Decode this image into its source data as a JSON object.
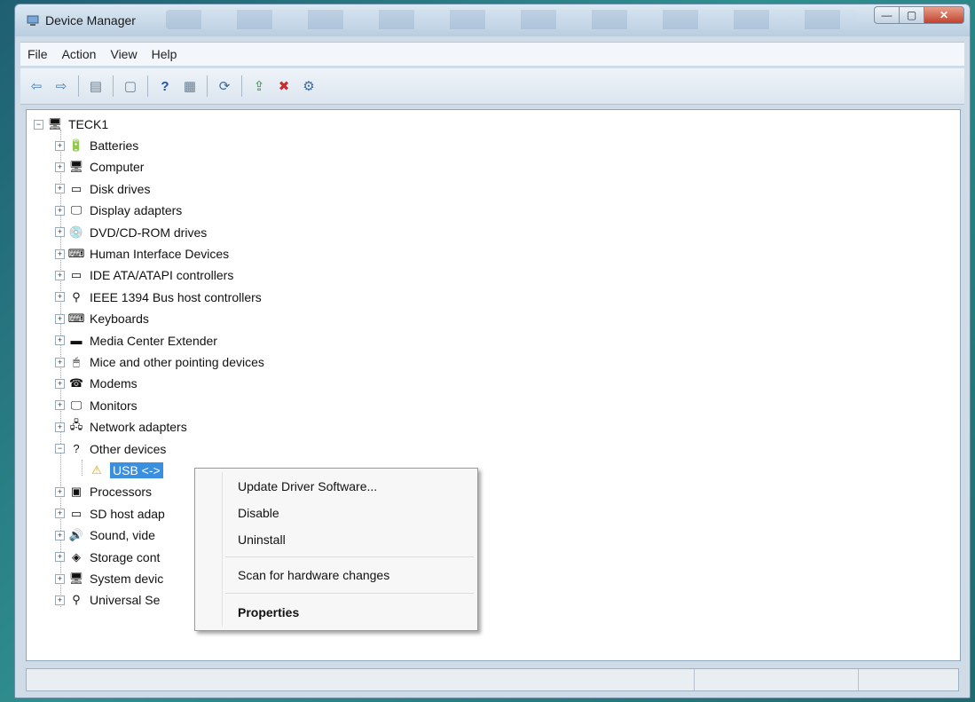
{
  "window": {
    "title": "Device Manager"
  },
  "menubar": [
    "File",
    "Action",
    "View",
    "Help"
  ],
  "toolbar": {
    "icons": [
      "back-arrow-icon",
      "forward-arrow-icon",
      "console-tree-icon",
      "properties-icon",
      "help-icon",
      "view-icon",
      "scan-hardware-icon",
      "update-driver-icon",
      "uninstall-icon",
      "disable-icon"
    ]
  },
  "tree": {
    "root": "TECK1",
    "items": [
      {
        "label": "Batteries",
        "icon": "battery-icon",
        "glyph": "🔋"
      },
      {
        "label": "Computer",
        "icon": "computer-icon",
        "glyph": "🖥"
      },
      {
        "label": "Disk drives",
        "icon": "disk-drive-icon",
        "glyph": "▭"
      },
      {
        "label": "Display adapters",
        "icon": "display-adapter-icon",
        "glyph": "🖵"
      },
      {
        "label": "DVD/CD-ROM drives",
        "icon": "dvd-drive-icon",
        "glyph": "💿"
      },
      {
        "label": "Human Interface Devices",
        "icon": "hid-icon",
        "glyph": "⌨"
      },
      {
        "label": "IDE ATA/ATAPI controllers",
        "icon": "ide-controller-icon",
        "glyph": "▭"
      },
      {
        "label": "IEEE 1394 Bus host controllers",
        "icon": "ieee1394-icon",
        "glyph": "⚲"
      },
      {
        "label": "Keyboards",
        "icon": "keyboard-icon",
        "glyph": "⌨"
      },
      {
        "label": "Media Center Extender",
        "icon": "media-center-icon",
        "glyph": "▬"
      },
      {
        "label": "Mice and other pointing devices",
        "icon": "mouse-icon",
        "glyph": "🖱"
      },
      {
        "label": "Modems",
        "icon": "modem-icon",
        "glyph": "☎"
      },
      {
        "label": "Monitors",
        "icon": "monitor-icon",
        "glyph": "🖵"
      },
      {
        "label": "Network adapters",
        "icon": "network-adapter-icon",
        "glyph": "🖧"
      },
      {
        "label": "Other devices",
        "icon": "other-devices-icon",
        "glyph": "?",
        "expanded": true
      },
      {
        "label": "USB <-> ",
        "icon": "warning-device-icon",
        "glyph": "⚠",
        "child": true,
        "selected": true
      },
      {
        "label": "Processors",
        "icon": "processor-icon",
        "glyph": "▣"
      },
      {
        "label": "SD host adap",
        "icon": "sd-host-icon",
        "glyph": "▭"
      },
      {
        "label": "Sound, vide",
        "icon": "sound-icon",
        "glyph": "🔊"
      },
      {
        "label": "Storage cont",
        "icon": "storage-controller-icon",
        "glyph": "◈"
      },
      {
        "label": "System devic",
        "icon": "system-device-icon",
        "glyph": "🖥"
      },
      {
        "label": "Universal Se",
        "icon": "usb-icon",
        "glyph": "⚲"
      }
    ]
  },
  "context_menu": {
    "items": [
      {
        "label": "Update Driver Software...",
        "bold": false
      },
      {
        "label": "Disable",
        "bold": false
      },
      {
        "label": "Uninstall",
        "bold": false
      },
      {
        "label": "Scan for hardware changes",
        "bold": false
      },
      {
        "label": "Properties",
        "bold": true
      }
    ]
  },
  "colors": {
    "selection": "#3b8fe0",
    "background": "#2f8f8f"
  }
}
